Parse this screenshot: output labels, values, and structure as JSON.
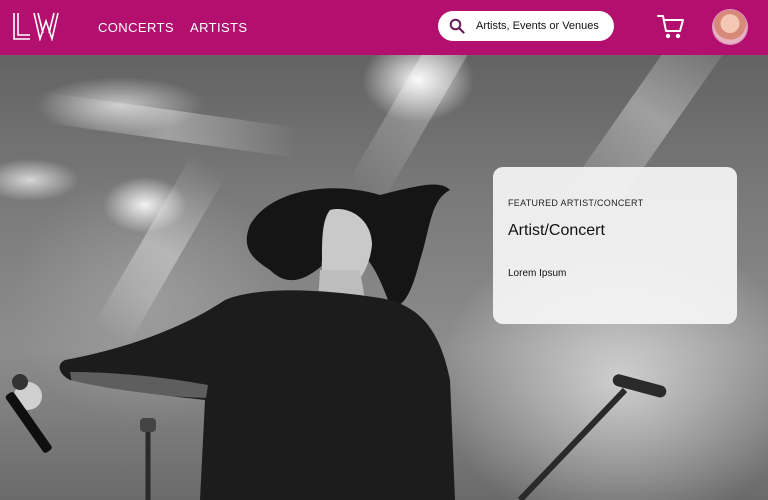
{
  "header": {
    "logo_text": "LW",
    "nav": [
      {
        "label": "CONCERTS"
      },
      {
        "label": "ARTISTS"
      }
    ],
    "search": {
      "placeholder": "Artists, Events or Venues",
      "icon": "search-icon"
    },
    "cart_icon": "cart-icon",
    "avatar": "user-avatar",
    "background_color": "#b30f6e"
  },
  "featured": {
    "kicker": "FEATURED ARTIST/CONCERT",
    "title": "Artist/Concert",
    "description": "Lorem Ipsum"
  }
}
